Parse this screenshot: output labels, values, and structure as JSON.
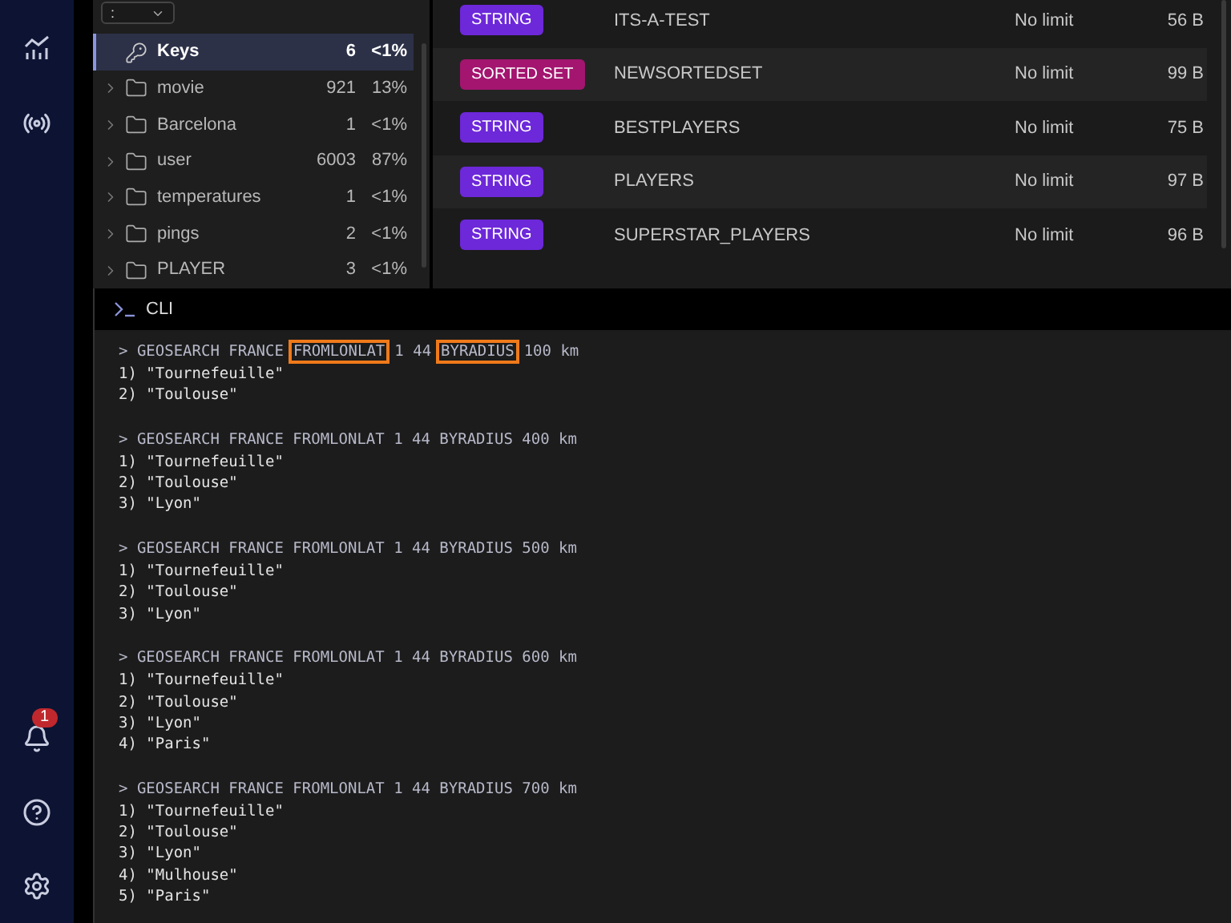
{
  "nav": {
    "notifications": "1"
  },
  "tree": {
    "delimiter": ":",
    "items": [
      {
        "name": "Keys",
        "count": "6",
        "percent": "<1%",
        "kind": "keys",
        "selected": true
      },
      {
        "name": "movie",
        "count": "921",
        "percent": "13%",
        "kind": "folder",
        "selected": false
      },
      {
        "name": "Barcelona",
        "count": "1",
        "percent": "<1%",
        "kind": "folder",
        "selected": false
      },
      {
        "name": "user",
        "count": "6003",
        "percent": "87%",
        "kind": "folder",
        "selected": false
      },
      {
        "name": "temperatures",
        "count": "1",
        "percent": "<1%",
        "kind": "folder",
        "selected": false
      },
      {
        "name": "pings",
        "count": "2",
        "percent": "<1%",
        "kind": "folder",
        "selected": false
      },
      {
        "name": "PLAYER",
        "count": "3",
        "percent": "<1%",
        "kind": "folder",
        "selected": false
      }
    ]
  },
  "keys": [
    {
      "type": "STRING",
      "color": "#6d28d9",
      "name": "ITS-A-TEST",
      "ttl": "No limit",
      "size": "56 B"
    },
    {
      "type": "SORTED SET",
      "color": "#a3156f",
      "name": "NEWSORTEDSET",
      "ttl": "No limit",
      "size": "99 B"
    },
    {
      "type": "STRING",
      "color": "#6d28d9",
      "name": "BESTPLAYERS",
      "ttl": "No limit",
      "size": "75 B"
    },
    {
      "type": "STRING",
      "color": "#6d28d9",
      "name": "PLAYERS",
      "ttl": "No limit",
      "size": "97 B"
    },
    {
      "type": "STRING",
      "color": "#6d28d9",
      "name": "SUPERSTAR_PLAYERS",
      "ttl": "No limit",
      "size": "96 B"
    }
  ],
  "cli": {
    "title": "CLI",
    "blocks": [
      {
        "command": [
          {
            "text": "> GEOSEARCH FRANCE",
            "highlighted": false
          },
          {
            "text": "FROMLONLAT",
            "highlighted": true
          },
          {
            "text": "1 44",
            "highlighted": false
          },
          {
            "text": "BYRADIUS",
            "highlighted": true
          },
          {
            "text": "100 km",
            "highlighted": false
          }
        ],
        "results": [
          "1) \"Tournefeuille\"",
          "2) \"Toulouse\""
        ]
      },
      {
        "command": [
          {
            "text": "> GEOSEARCH FRANCE FROMLONLAT 1 44 BYRADIUS 400 km",
            "highlighted": false
          }
        ],
        "results": [
          "1) \"Tournefeuille\"",
          "2) \"Toulouse\"",
          "3) \"Lyon\""
        ]
      },
      {
        "command": [
          {
            "text": "> GEOSEARCH FRANCE FROMLONLAT 1 44 BYRADIUS 500 km",
            "highlighted": false
          }
        ],
        "results": [
          "1) \"Tournefeuille\"",
          "2) \"Toulouse\"",
          "3) \"Lyon\""
        ]
      },
      {
        "command": [
          {
            "text": "> GEOSEARCH FRANCE FROMLONLAT 1 44 BYRADIUS 600 km",
            "highlighted": false
          }
        ],
        "results": [
          "1) \"Tournefeuille\"",
          "2) \"Toulouse\"",
          "3) \"Lyon\"",
          "4) \"Paris\""
        ]
      },
      {
        "command": [
          {
            "text": "> GEOSEARCH FRANCE FROMLONLAT 1 44 BYRADIUS 700 km",
            "highlighted": false
          }
        ],
        "results": [
          "1) \"Tournefeuille\"",
          "2) \"Toulouse\"",
          "3) \"Lyon\"",
          "4) \"Mulhouse\"",
          "5) \"Paris\""
        ]
      }
    ]
  }
}
